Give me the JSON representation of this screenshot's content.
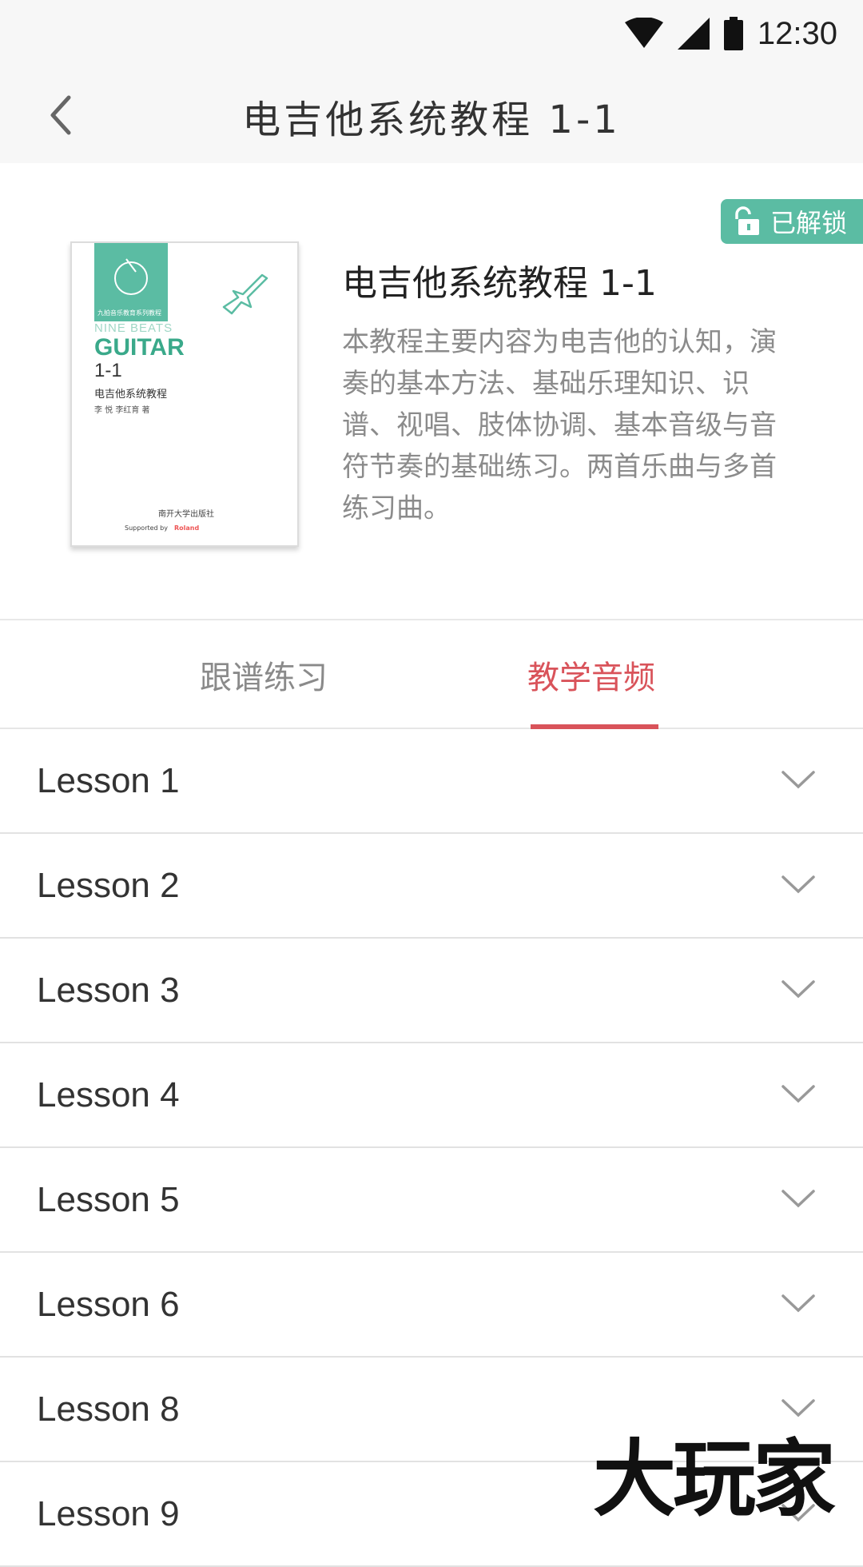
{
  "status_bar": {
    "time": "12:30"
  },
  "header": {
    "title": "电吉他系统教程 1-1"
  },
  "book": {
    "badge": "已解锁",
    "title": "电吉他系统教程 1-1",
    "description": "本教程主要内容为电吉他的认知，演奏的基本方法、基础乐理知识、识谱、视唱、肢体协调、基本音级与音符节奏的基础练习。两首乐曲与多首练习曲。",
    "cover": {
      "series": "九拍音乐教育系列教程",
      "brand": "NINE BEATS",
      "subject": "GUITAR",
      "number": "1-1",
      "cn_title": "电吉他系统教程",
      "authors": "李 悦   李红育   著",
      "publisher": "南开大学出版社",
      "supported_by": "Supported by",
      "sponsor": "Roland"
    }
  },
  "tabs": [
    {
      "label": "跟谱练习",
      "active": false
    },
    {
      "label": "教学音频",
      "active": true
    }
  ],
  "lessons": [
    {
      "label": "Lesson 1"
    },
    {
      "label": "Lesson 2"
    },
    {
      "label": "Lesson 3"
    },
    {
      "label": "Lesson 4"
    },
    {
      "label": "Lesson 5"
    },
    {
      "label": "Lesson 6"
    },
    {
      "label": "Lesson 8"
    },
    {
      "label": "Lesson 9"
    }
  ],
  "watermark": "大玩家",
  "colors": {
    "accent": "#d9535a",
    "badge": "#5bbca3",
    "header_bg": "#f7f7f7"
  },
  "icons": [
    "wifi-icon",
    "signal-icon",
    "battery-icon",
    "back-arrow-icon",
    "unlock-icon",
    "chevron-down-icon",
    "guitar-icon"
  ]
}
